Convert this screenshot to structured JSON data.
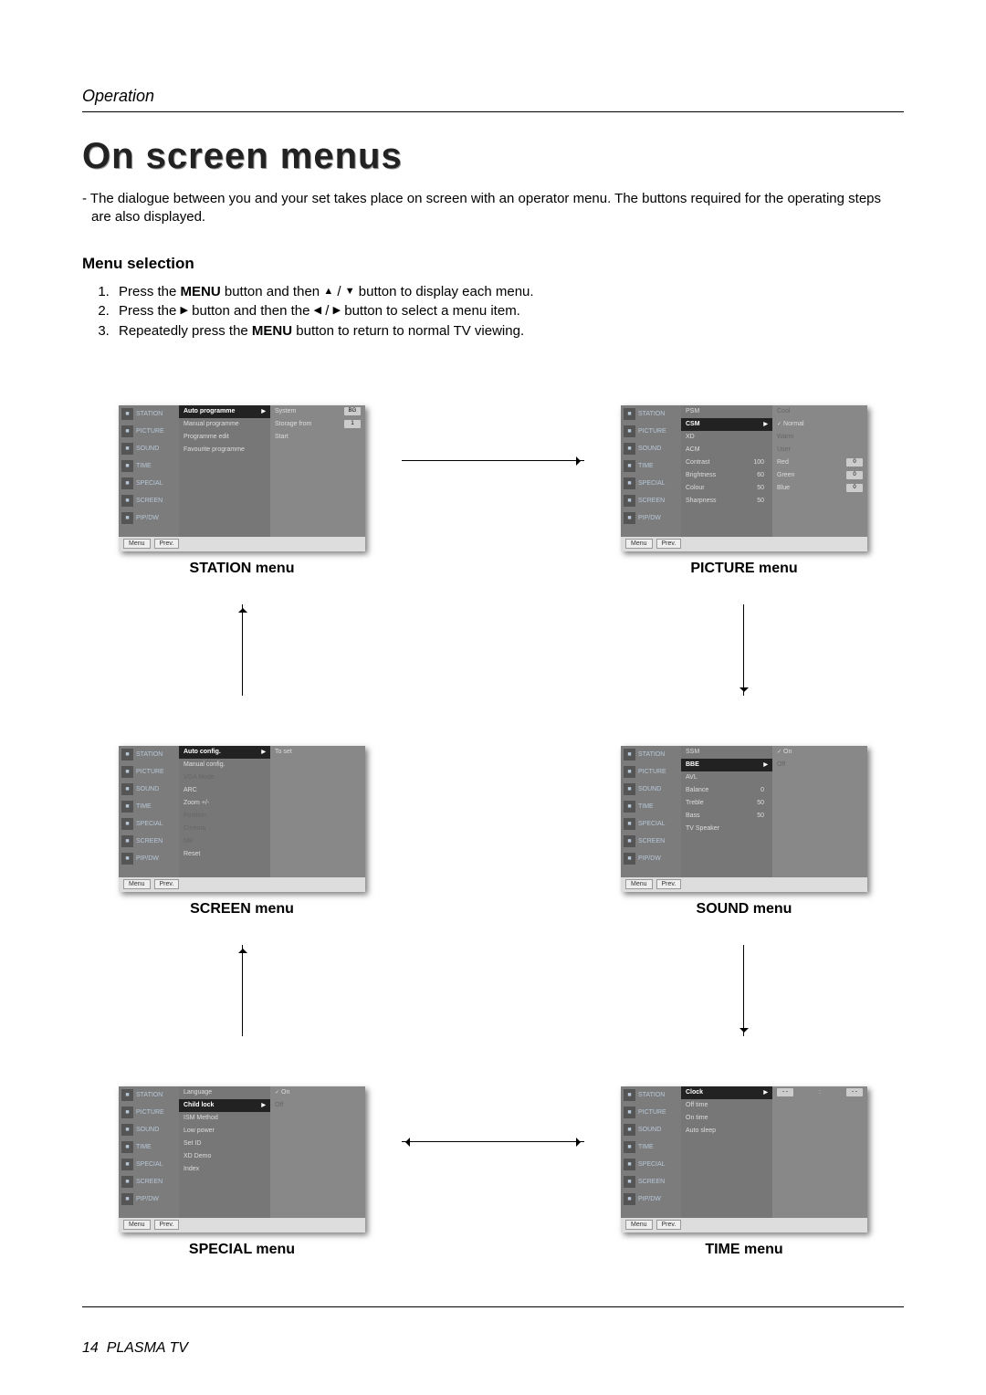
{
  "header": {
    "section": "Operation"
  },
  "title": "On screen menus",
  "intro_prefix": "- ",
  "intro": "The dialogue between you and your set takes place on screen with an operator menu. The buttons required for the operating steps are also displayed.",
  "menu_selection_heading": "Menu selection",
  "steps": {
    "s1a": "Press the ",
    "s1b": "MENU",
    "s1c": " button and then ",
    "s1d": "▲",
    "s1e": " / ",
    "s1f": "▼",
    "s1g": " button to display each menu.",
    "s2a": "Press the ",
    "s2b": "▶",
    "s2c": " button and then the ",
    "s2d": "◀",
    "s2e": " / ",
    "s2f": "▶",
    "s2g": " button to select a menu item.",
    "s3a": "Repeatedly press the ",
    "s3b": "MENU",
    "s3c": " button to return to normal TV viewing."
  },
  "sidebar_items": [
    "STATION",
    "PICTURE",
    "SOUND",
    "TIME",
    "SPECIAL",
    "SCREEN",
    "PIP/DW"
  ],
  "footer_buttons": {
    "menu": "Menu",
    "prev": "Prev."
  },
  "captions": {
    "station": "STATION menu",
    "picture": "PICTURE menu",
    "screen": "SCREEN menu",
    "sound": "SOUND menu",
    "special": "SPECIAL menu",
    "time": "TIME menu"
  },
  "station_menu": {
    "col1": [
      {
        "label": "Auto programme",
        "hl": true,
        "tri": true
      },
      {
        "label": "Manual programme"
      },
      {
        "label": "Programme edit"
      },
      {
        "label": "Favourite programme"
      }
    ],
    "col2": [
      {
        "label": "System",
        "pill": "BG"
      },
      {
        "label": "Storage from",
        "pill": "1"
      },
      {
        "label": "Start"
      }
    ]
  },
  "picture_menu": {
    "col1": [
      {
        "label": "PSM"
      },
      {
        "label": "CSM",
        "hl": true,
        "tri": true
      },
      {
        "label": "XD"
      },
      {
        "label": "ACM"
      },
      {
        "label": "Contrast",
        "val": "100"
      },
      {
        "label": "Brightness",
        "val": "60"
      },
      {
        "label": "Colour",
        "val": "50"
      },
      {
        "label": "Sharpness",
        "val": "50"
      }
    ],
    "col2": [
      {
        "label": "Cool",
        "dim": true
      },
      {
        "label": "Normal",
        "chk": true
      },
      {
        "label": "Warm",
        "dim": true
      },
      {
        "label": "User",
        "dim": true
      },
      {
        "label": "Red",
        "pill": "0"
      },
      {
        "label": "Green",
        "pill": "0"
      },
      {
        "label": "Blue",
        "pill": "0"
      }
    ]
  },
  "screen_menu": {
    "col1": [
      {
        "label": "Auto config.",
        "hl": true,
        "tri": true
      },
      {
        "label": "Manual config."
      },
      {
        "label": "VGA Mode",
        "dim": true
      },
      {
        "label": "ARC"
      },
      {
        "label": "Zoom +/-"
      },
      {
        "label": "Position",
        "dim": true
      },
      {
        "label": "Cinema",
        "dim": true
      },
      {
        "label": "NR",
        "dim": true
      },
      {
        "label": "Reset"
      }
    ],
    "col2": [
      {
        "label": "To set"
      }
    ]
  },
  "sound_menu": {
    "col1": [
      {
        "label": "SSM"
      },
      {
        "label": "BBE",
        "hl": true,
        "tri": true
      },
      {
        "label": "AVL"
      },
      {
        "label": "Balance",
        "val": "0"
      },
      {
        "label": "Treble",
        "val": "50"
      },
      {
        "label": "Bass",
        "val": "50"
      },
      {
        "label": "TV Speaker"
      }
    ],
    "col2": [
      {
        "label": "On",
        "chk": true
      },
      {
        "label": "Off",
        "dim": true
      }
    ]
  },
  "special_menu": {
    "col1": [
      {
        "label": "Language"
      },
      {
        "label": "Child lock",
        "hl": true,
        "tri": true
      },
      {
        "label": "ISM Method"
      },
      {
        "label": "Low power"
      },
      {
        "label": "Set ID"
      },
      {
        "label": "XD Demo"
      },
      {
        "label": "Index"
      }
    ],
    "col2": [
      {
        "label": "On",
        "chk": true
      },
      {
        "label": "Off",
        "dim": true
      }
    ]
  },
  "time_menu": {
    "col1": [
      {
        "label": "Clock",
        "hl": true,
        "tri": true
      },
      {
        "label": "Off time"
      },
      {
        "label": "On time"
      },
      {
        "label": "Auto sleep"
      }
    ],
    "col2": [
      {
        "label": "",
        "pill": "- -"
      },
      {
        "label": "",
        "pill": "- -"
      }
    ],
    "clock_sep": ":"
  },
  "footer": {
    "page": "14",
    "product": "PLASMA TV"
  }
}
